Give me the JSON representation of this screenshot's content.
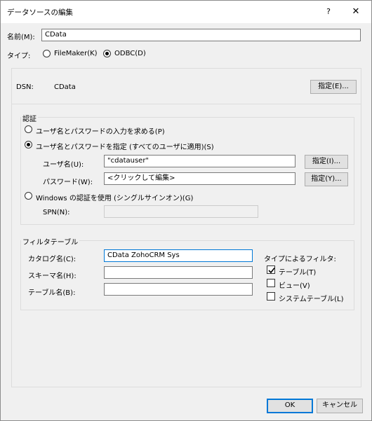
{
  "window": {
    "title": "データソースの編集",
    "help_label": "?",
    "close_label": "✕"
  },
  "name": {
    "label": "名前(M):",
    "value": "CData"
  },
  "type": {
    "label": "タイプ:",
    "options": [
      {
        "label": "FileMaker(K)",
        "selected": false
      },
      {
        "label": "ODBC(D)",
        "selected": true
      }
    ]
  },
  "dsn": {
    "label": "DSN:",
    "value": "CData",
    "button": "指定(E)..."
  },
  "auth": {
    "title": "認証",
    "option_prompt": "ユーザ名とパスワードの入力を求める(P)",
    "option_specify": "ユーザ名とパスワードを指定 (すべてのユーザに適用)(S)",
    "username_label": "ユーザ名(U):",
    "username_value": "\"cdatauser\"",
    "username_button": "指定(I)...",
    "password_label": "パスワード(W):",
    "password_value": "<クリックして編集>",
    "password_button": "指定(Y)...",
    "option_windows": "Windows の認証を使用 (シングルサインオン)(G)",
    "spn_label": "SPN(N):",
    "spn_value": "",
    "selected": "specify"
  },
  "filter": {
    "title": "フィルタテーブル",
    "catalog_label": "カタログ名(C):",
    "catalog_value": "CData ZohoCRM Sys",
    "schema_label": "スキーマ名(H):",
    "schema_value": "",
    "table_label": "テーブル名(B):",
    "table_value": "",
    "type_filter_label": "タイプによるフィルタ:",
    "type_filters": [
      {
        "label": "テーブル(T)",
        "checked": true
      },
      {
        "label": "ビュー(V)",
        "checked": false
      },
      {
        "label": "システムテーブル(L)",
        "checked": false
      }
    ]
  },
  "footer": {
    "ok_label": "OK",
    "cancel_label": "キャンセル"
  }
}
